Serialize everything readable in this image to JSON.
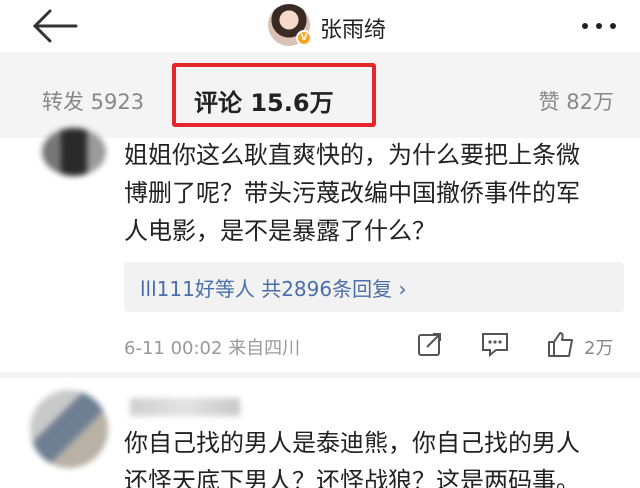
{
  "header": {
    "back_icon": "arrow-left-icon",
    "title": "张雨绮",
    "verified_icon": "v-badge-icon",
    "more_icon": "more-dots-icon"
  },
  "stats": {
    "repost": "转发 5923",
    "comment": "评论 15.6万",
    "like": "赞 82万",
    "highlight_color": "#e5262a"
  },
  "comments": [
    {
      "lines": [
        "姐姐你这么耿直爽快的，为什么要把上条微",
        "博删了呢？带头污蔑改编中国撤侨事件的军",
        "人电影，是不是暴露了什么？"
      ],
      "reply_summary": "lll111好等人  共2896条回复 ›",
      "meta": "6-11 00:02  来自四川",
      "like_count": "2万"
    },
    {
      "lines": [
        "你自己找的男人是泰迪熊，你自己找的男人",
        "还怪天底下男人？还怪战狼？这是两码事。"
      ]
    }
  ],
  "colors": {
    "link": "#4a6ea9",
    "muted": "#999999",
    "bar_bg": "#f4f4f4"
  }
}
